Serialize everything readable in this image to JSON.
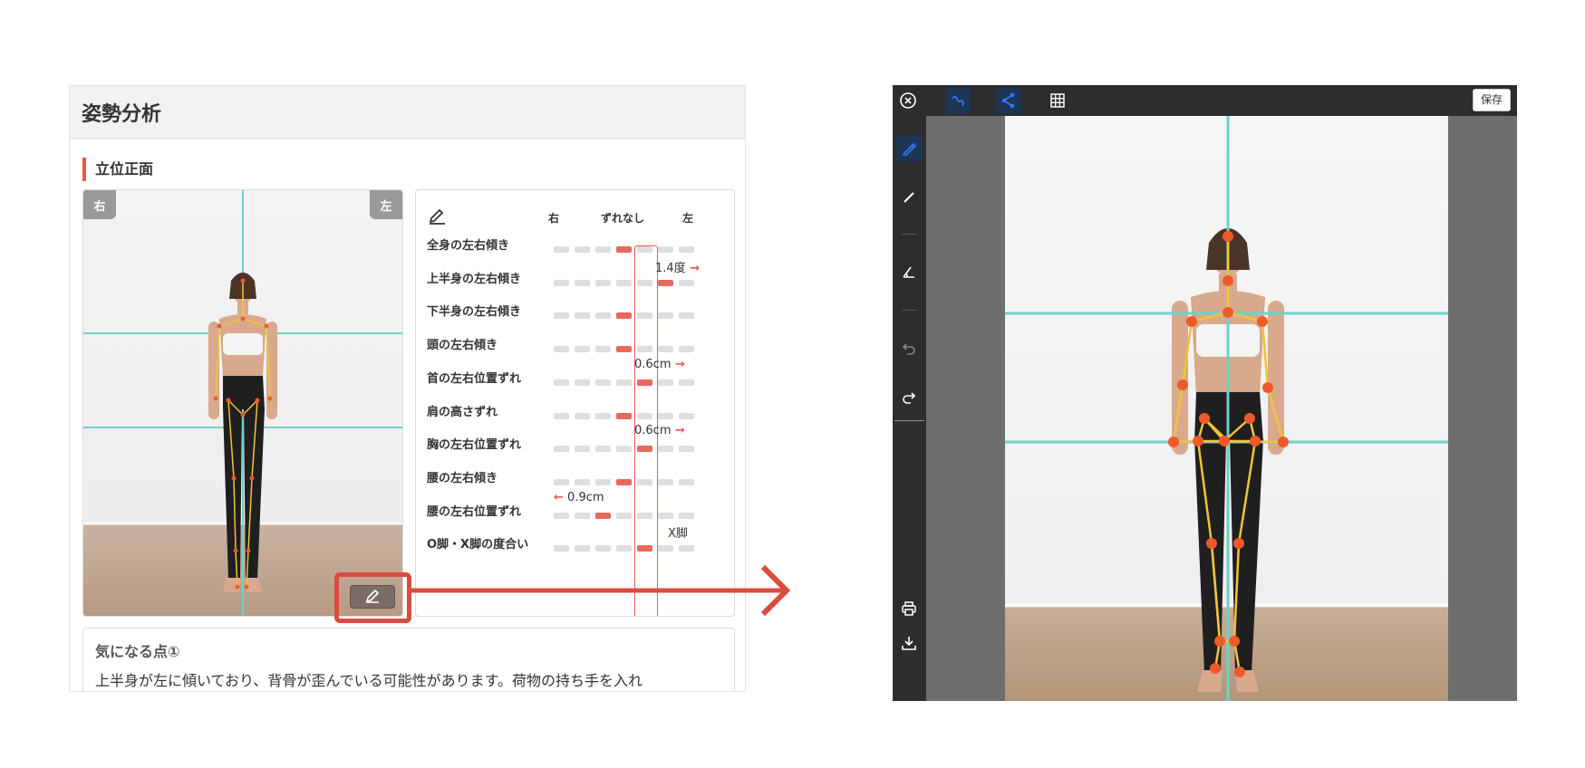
{
  "page": {
    "title": "姿勢分析",
    "section": "立位正面"
  },
  "photo": {
    "badge_right": "右",
    "badge_left": "左",
    "edit_icon": "pencil-icon"
  },
  "metrics": {
    "header_edit_icon": "pencil-icon",
    "scale_right": "右",
    "scale_center": "ずれなし",
    "scale_left": "左",
    "rows": [
      {
        "label": "全身の左右傾き",
        "position": 0,
        "note": "",
        "note_dir": ""
      },
      {
        "label": "上半身の左右傾き",
        "position": 2,
        "note": "1.4度",
        "note_dir": "right"
      },
      {
        "label": "下半身の左右傾き",
        "position": 0,
        "note": "",
        "note_dir": ""
      },
      {
        "label": "頭の左右傾き",
        "position": 0,
        "note": "",
        "note_dir": ""
      },
      {
        "label": "首の左右位置ずれ",
        "position": 1,
        "note": "0.6cm",
        "note_dir": "right"
      },
      {
        "label": "肩の高さずれ",
        "position": 0,
        "note": "",
        "note_dir": ""
      },
      {
        "label": "胸の左右位置ずれ",
        "position": 1,
        "note": "0.6cm",
        "note_dir": "right"
      },
      {
        "label": "腰の左右傾き",
        "position": 0,
        "note": "",
        "note_dir": ""
      },
      {
        "label": "腰の左右位置ずれ",
        "position": -1,
        "note": "0.9cm",
        "note_dir": "left"
      },
      {
        "label": "O脚・X脚の度合い",
        "position": 1,
        "note": "X脚",
        "note_dir": ""
      }
    ]
  },
  "notes": {
    "title": "気になる点①",
    "text": "上半身が左に傾いており、背骨が歪んでいる可能性があります。荷物の持ち手を入れ"
  },
  "editor": {
    "save_label": "保存",
    "top_icons": [
      "close-circle-icon",
      "freehand-icon",
      "skeleton-icon",
      "grid-icon"
    ],
    "side_icons": [
      "pencil-icon",
      "line-icon",
      "angle-icon",
      "undo-icon",
      "redo-icon",
      "print-icon",
      "download-icon"
    ]
  },
  "colors": {
    "accent": "#e85a4f",
    "bar_on": "#e8685c",
    "bar_off": "#dedede",
    "guide_line": "#6fd0c6",
    "skeleton_line": "#f2c33a",
    "skeleton_point": "#ef5a2a",
    "editor_dark": "#2d2d2d",
    "editor_active": "#2f7bef"
  }
}
